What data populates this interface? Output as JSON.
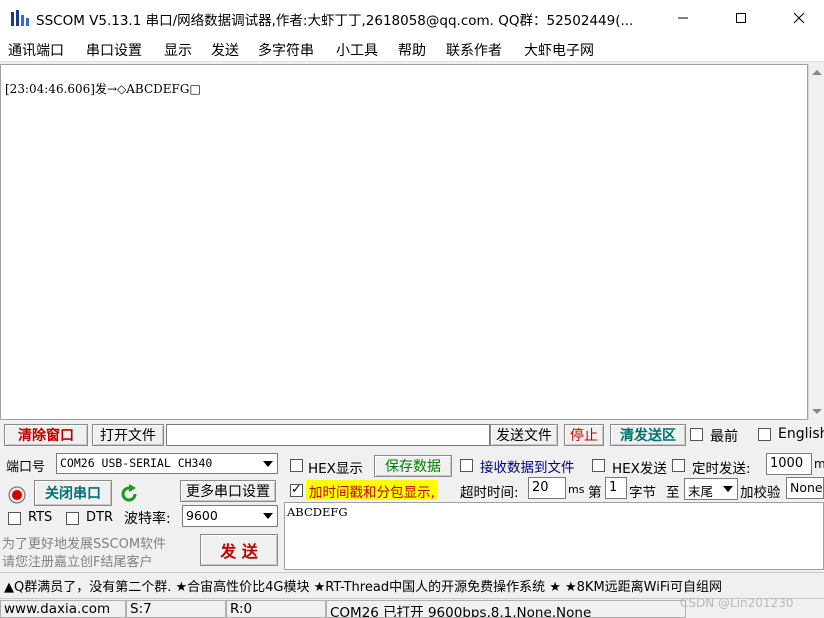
{
  "window": {
    "title": "SSCOM V5.13.1 串口/网络数据调试器,作者:大虾丁丁,2618058@qq.com. QQ群：52502449(..."
  },
  "menu": [
    "通讯端口",
    "串口设置",
    "显示",
    "发送",
    "多字符串",
    "小工具",
    "帮助",
    "联系作者",
    "大虾电子网"
  ],
  "receive": {
    "log": "[23:04:46.606]发→◇ABCDEFG□"
  },
  "toolbar": {
    "clear_window": "清除窗口",
    "open_file": "打开文件",
    "file_path": "",
    "send_file": "发送文件",
    "stop": "停止",
    "clear_send": "清发送区",
    "topmost_label": "最前",
    "topmost_checked": false,
    "english_label": "English",
    "english_checked": false
  },
  "port": {
    "port_label": "端口号",
    "port_value": "COM26 USB-SERIAL CH340",
    "close_port": "关闭串口",
    "more_settings": "更多串口设置",
    "rts_label": "RTS",
    "dtr_label": "DTR",
    "baud_label": "波特率:",
    "baud_value": "9600"
  },
  "options": {
    "hex_display": "HEX显示",
    "save_data": "保存数据",
    "recv_to_file": "接收数据到文件",
    "hex_send": "HEX发送",
    "timed_send": "定时发送:",
    "timed_interval": "1000",
    "timed_unit": "m",
    "add_timestamp": "加时间戳和分包显示,",
    "add_timestamp_checked": true,
    "timeout_label": "超时时间:",
    "timeout_value": "20",
    "timeout_unit": "ms",
    "nth_label": "第",
    "nth_value": "1",
    "byte_label": "字节",
    "to_label": "至",
    "end_value": "末尾",
    "checksum_label": "加校验",
    "checksum_value": "None"
  },
  "promo": {
    "line1": "为了更好地发展SSCOM软件",
    "line2": "请您注册嘉立创F结尾客户"
  },
  "send": {
    "button": "发  送",
    "text": "ABCDEFG"
  },
  "ticker": "▲Q群满员了，没有第二个群. ★合宙高性价比4G模块 ★RT-Thread中国人的开源免费操作系统 ★ ★8KM远距离WiFi可自组网",
  "status": {
    "website": "www.daxia.com",
    "sent": "S:7",
    "received": "R:0",
    "port_status": "COM26 已打开  9600bps,8,1,None,None"
  },
  "watermark": "CSDN @Lin201230",
  "colors": {
    "accent_red": "#c00000",
    "accent_teal": "#007070",
    "timestamp_highlight": "#ffff00"
  }
}
